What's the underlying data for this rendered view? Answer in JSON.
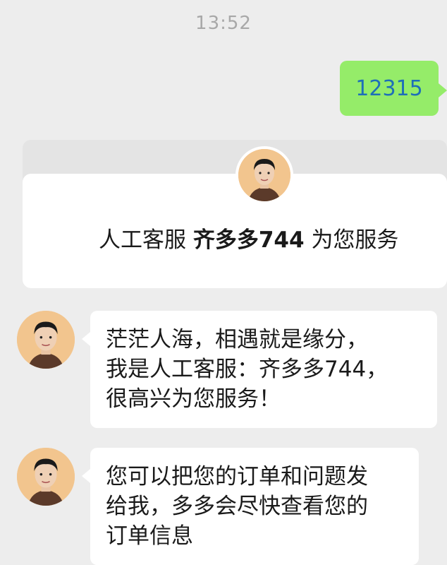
{
  "chat": {
    "timestamp": "13:52",
    "sent_message": "12315",
    "service_card": {
      "prefix": "人工客服",
      "agent_name": "齐多多744",
      "suffix": "为您服务"
    },
    "messages": [
      {
        "lines": [
          "茫茫人海，相遇就是缘分，",
          "我是人工客服：齐多多744，",
          "很高兴为您服务！"
        ]
      },
      {
        "lines": [
          "您可以把您的订单和问题发",
          "给我，多多会尽快查看您的",
          "订单信息"
        ]
      }
    ]
  },
  "colors": {
    "background": "#ededed",
    "sent_bubble": "#95ec69",
    "sent_text": "#1e6fb8",
    "received_bubble": "#ffffff",
    "avatar_bg": "#f2c58e"
  }
}
